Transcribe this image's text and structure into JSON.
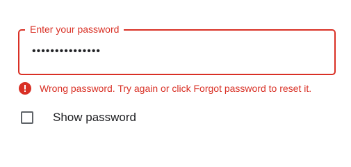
{
  "password_field": {
    "label": "Enter your password",
    "value": "•••••••••••••••"
  },
  "error": {
    "icon": "error-icon",
    "message": "Wrong password. Try again or click Forgot password to reset it."
  },
  "show_password": {
    "label": "Show password",
    "checked": false
  },
  "colors": {
    "error": "#d93025",
    "text": "#202124",
    "checkbox_border": "#5f6368",
    "background": "#ffffff"
  }
}
